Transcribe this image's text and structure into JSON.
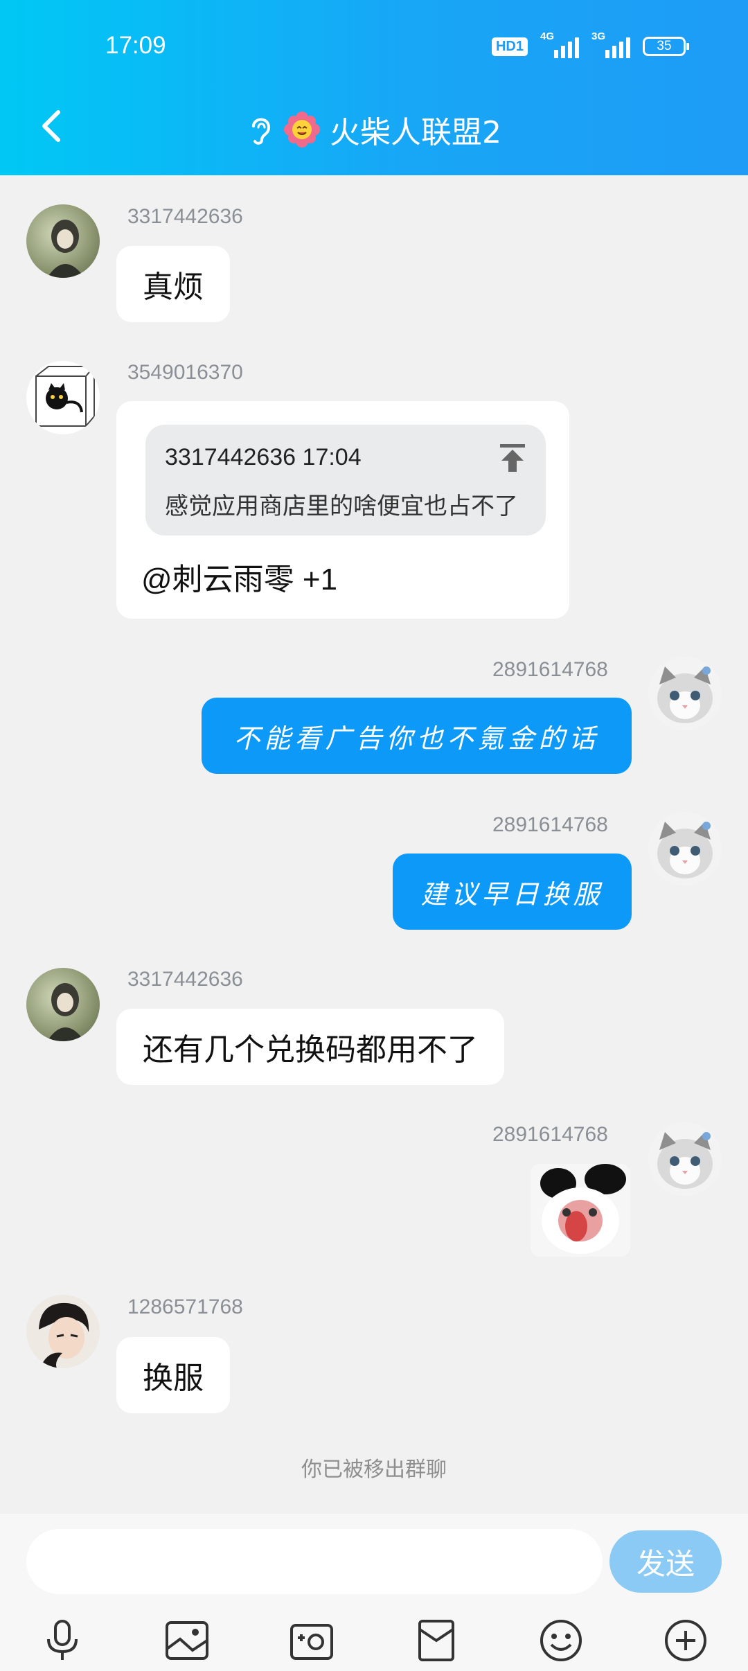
{
  "status_bar": {
    "time": "17:09",
    "hd_badge": "HD1",
    "signal1_label": "4G",
    "signal2_label": "3G",
    "battery": "35"
  },
  "header": {
    "title": "火柴人联盟2",
    "back_icon": "chevron-left-icon",
    "ear_icon": "ear-icon",
    "group_icon": "flower-emoji-icon"
  },
  "messages": [
    {
      "side": "left",
      "user": "3317442636",
      "text": "真烦"
    },
    {
      "side": "left",
      "user": "3549016370",
      "quote": {
        "header": "3317442636 17:04",
        "text": "感觉应用商店里的啥便宜也占不了"
      },
      "text": "@刺云雨零 +1"
    },
    {
      "side": "right",
      "user": "2891614768",
      "text": "不能看广告你也不氪金的话"
    },
    {
      "side": "right",
      "user": "2891614768",
      "text": "建议早日换服"
    },
    {
      "side": "left",
      "user": "3317442636",
      "text": "还有几个兑换码都用不了"
    },
    {
      "side": "right",
      "user": "2891614768",
      "image": "panda-meme-sticker"
    },
    {
      "side": "left",
      "user": "1286571768",
      "text": "换服"
    }
  ],
  "system_note": "你已被移出群聊",
  "composer": {
    "input_value": "",
    "input_placeholder": "",
    "send_label": "发送"
  },
  "toolbar": [
    "mic-icon",
    "image-icon",
    "camera-icon",
    "red-packet-icon",
    "emoji-icon",
    "plus-icon"
  ],
  "colors": {
    "header_gradient_start": "#00c8f5",
    "header_gradient_end": "#1e9cf6",
    "bubble_self": "#0d99f8",
    "send_button": "#8ccaf6",
    "background": "#f1f1f1"
  }
}
